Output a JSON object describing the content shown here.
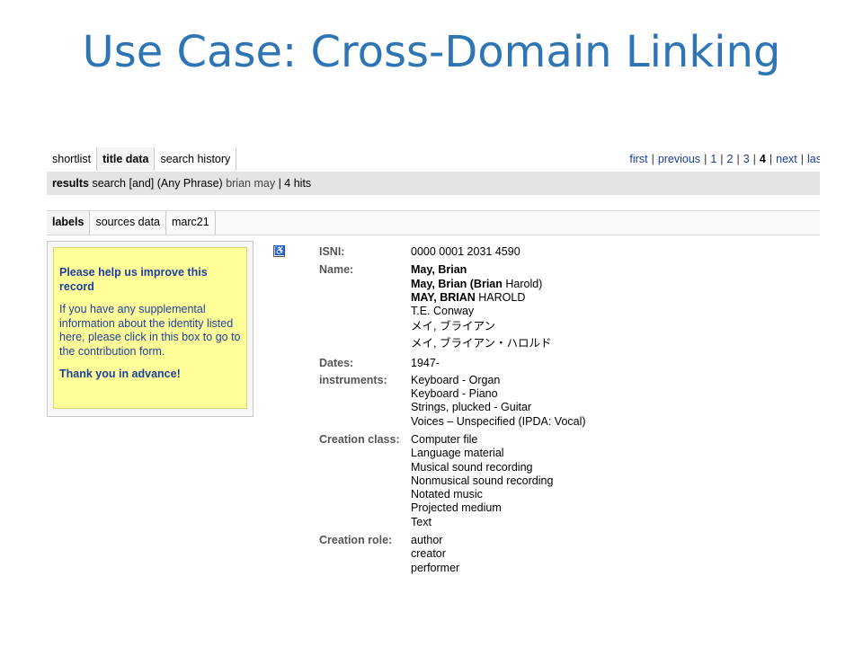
{
  "slide": {
    "title": "Use Case: Cross-Domain Linking"
  },
  "tabs": [
    {
      "label": "shortlist"
    },
    {
      "label": "title data",
      "active": true
    },
    {
      "label": "search history"
    }
  ],
  "pager": {
    "first": "first",
    "previous": "previous",
    "pages": [
      "1",
      "2",
      "3",
      "4"
    ],
    "current": "4",
    "next": "next",
    "last": "las"
  },
  "results": {
    "label": "results",
    "query_prefix": "search [and] (Any Phrase)",
    "query_value": "brian may",
    "hits": "4 hits"
  },
  "view_tabs": [
    {
      "label": "labels",
      "active": true
    },
    {
      "label": "sources data"
    },
    {
      "label": "marc21"
    }
  ],
  "help_box": {
    "heading": "Please help us improve this record",
    "body": "If you have any supplemental information about the identity listed here, please click in this box to go to the contribution form.",
    "thanks": "Thank you in advance!"
  },
  "record": {
    "isni": {
      "label": "ISNI:",
      "value": "0000 0001 2031 4590"
    },
    "name": {
      "label": "Name:",
      "lines": [
        {
          "a": "May, Brian",
          "b": ""
        },
        {
          "a": "May, Brian (Brian",
          "b": " Harold)"
        },
        {
          "a": "MAY, BRIAN",
          "b": " HAROLD"
        },
        {
          "a": "",
          "b": "T.E. Conway"
        }
      ],
      "jp": [
        "メイ, ブライアン",
        "メイ, ブライアン・ハロルド"
      ]
    },
    "dates": {
      "label": "Dates:",
      "value": "1947-"
    },
    "instruments": {
      "label": "instruments:",
      "values": [
        "Keyboard - Organ",
        "Keyboard - Piano",
        "Strings, plucked - Guitar",
        "Voices – Unspecified (IPDA: Vocal)"
      ]
    },
    "creation_class": {
      "label": "Creation class:",
      "values": [
        "Computer file",
        "Language material",
        "Musical sound recording",
        "Nonmusical sound recording",
        "Notated music",
        "Projected medium",
        "Text"
      ]
    },
    "creation_role": {
      "label": "Creation role:",
      "values": [
        "author",
        "creator",
        "performer"
      ]
    }
  }
}
